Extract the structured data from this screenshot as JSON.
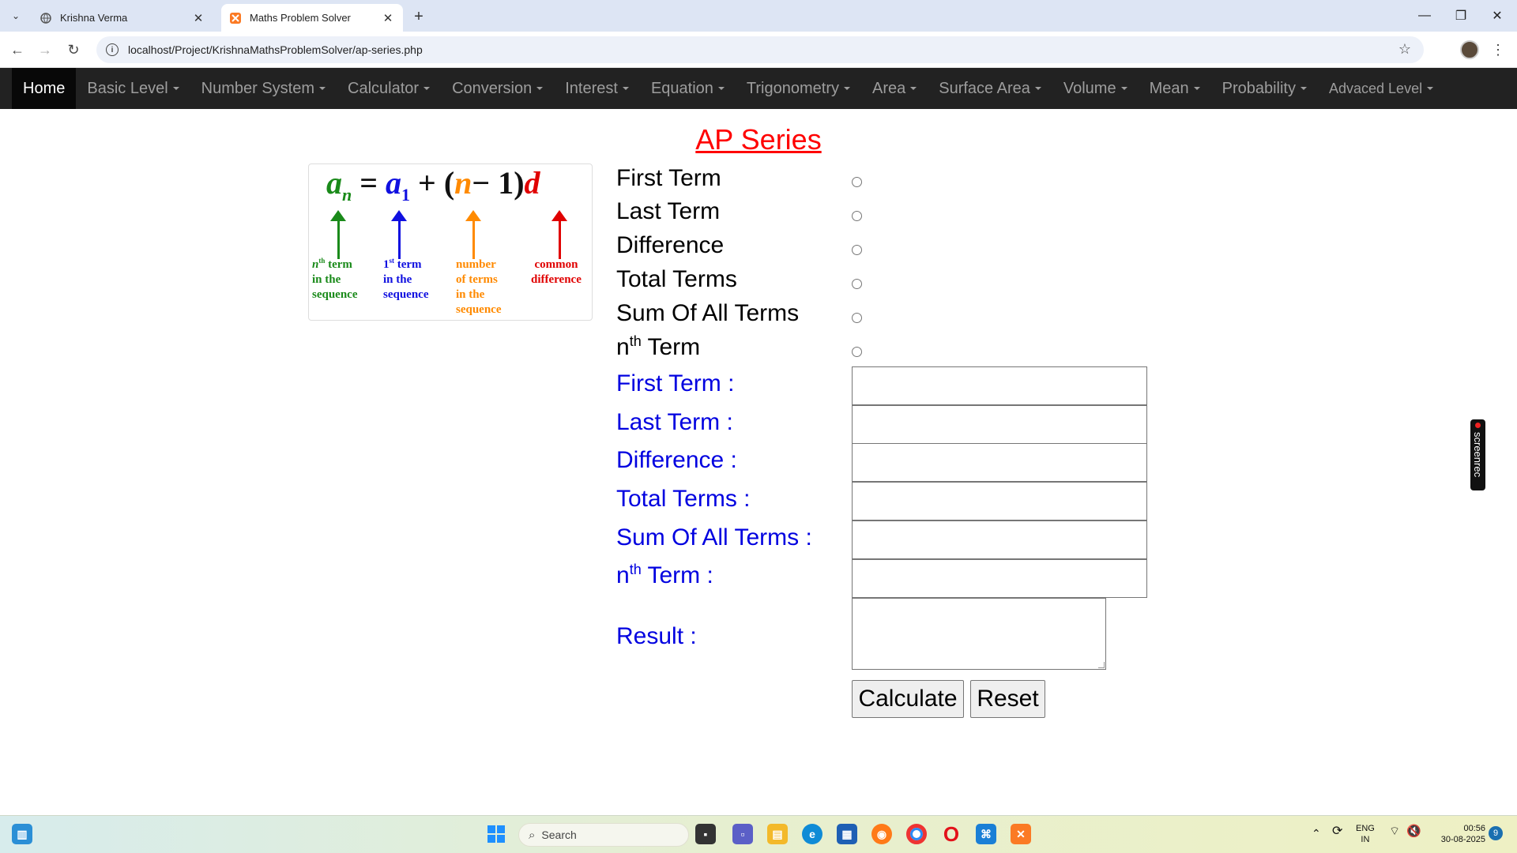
{
  "browser": {
    "tabs": [
      {
        "title": "Krishna Verma",
        "active": false
      },
      {
        "title": "Maths Problem Solver",
        "active": true
      }
    ],
    "url": "localhost/Project/KrishnaMathsProblemSolver/ap-series.php",
    "icons": {
      "back": "back-arrow-icon",
      "forward": "forward-arrow-icon",
      "reload": "reload-icon",
      "bookmark": "star-icon"
    }
  },
  "nav": {
    "items": [
      {
        "label": "Home"
      },
      {
        "label": "Basic Level"
      },
      {
        "label": "Number System"
      },
      {
        "label": "Calculator"
      },
      {
        "label": "Conversion"
      },
      {
        "label": "Interest"
      },
      {
        "label": "Equation"
      },
      {
        "label": "Trigonometry"
      },
      {
        "label": "Area"
      },
      {
        "label": "Surface Area"
      },
      {
        "label": "Volume"
      },
      {
        "label": "Mean"
      },
      {
        "label": "Probability"
      },
      {
        "label": "Advaced Level"
      }
    ]
  },
  "page": {
    "title": "AP Series",
    "formula": {
      "an": "a",
      "an_sub": "n",
      "eq": "=",
      "a1": "a",
      "a1_sub": "1",
      "plus": "+",
      "open": "(",
      "n": "n",
      "minus_one": "− 1)",
      "d": "d",
      "label_nth_1": "n",
      "label_nth_sup": "th",
      "label_nth_2": " term",
      "label_nth_3": "in the",
      "label_nth_4": "sequence",
      "label_first_1": "1",
      "label_first_sup": "st",
      "label_first_2": " term",
      "label_first_3": "in the",
      "label_first_4": "sequence",
      "label_num_1": "number",
      "label_num_2": "of terms",
      "label_num_3": "in the",
      "label_num_4": "sequence",
      "label_cd_1": "common",
      "label_cd_2": "difference"
    },
    "options": {
      "first": "First Term",
      "last": "Last Term",
      "diff": "Difference",
      "total": "Total Terms",
      "sum": "Sum Of All Terms",
      "nth_n": "n",
      "nth_sup": "th",
      "nth_rest": " Term"
    },
    "fields": {
      "first": "First Term :",
      "last": "Last Term :",
      "diff": "Difference :",
      "total": "Total Terms :",
      "sum": "Sum Of All Terms :",
      "nth_n": "n",
      "nth_sup": "th",
      "nth_rest": " Term :",
      "result": "Result :"
    },
    "buttons": {
      "calculate": "Calculate",
      "reset": "Reset"
    },
    "screenrec": "screenrec"
  },
  "taskbar": {
    "search_placeholder": "Search",
    "lang_1": "ENG",
    "lang_2": "IN",
    "time": "00:56",
    "date": "30-08-2025",
    "notifications": "9"
  }
}
